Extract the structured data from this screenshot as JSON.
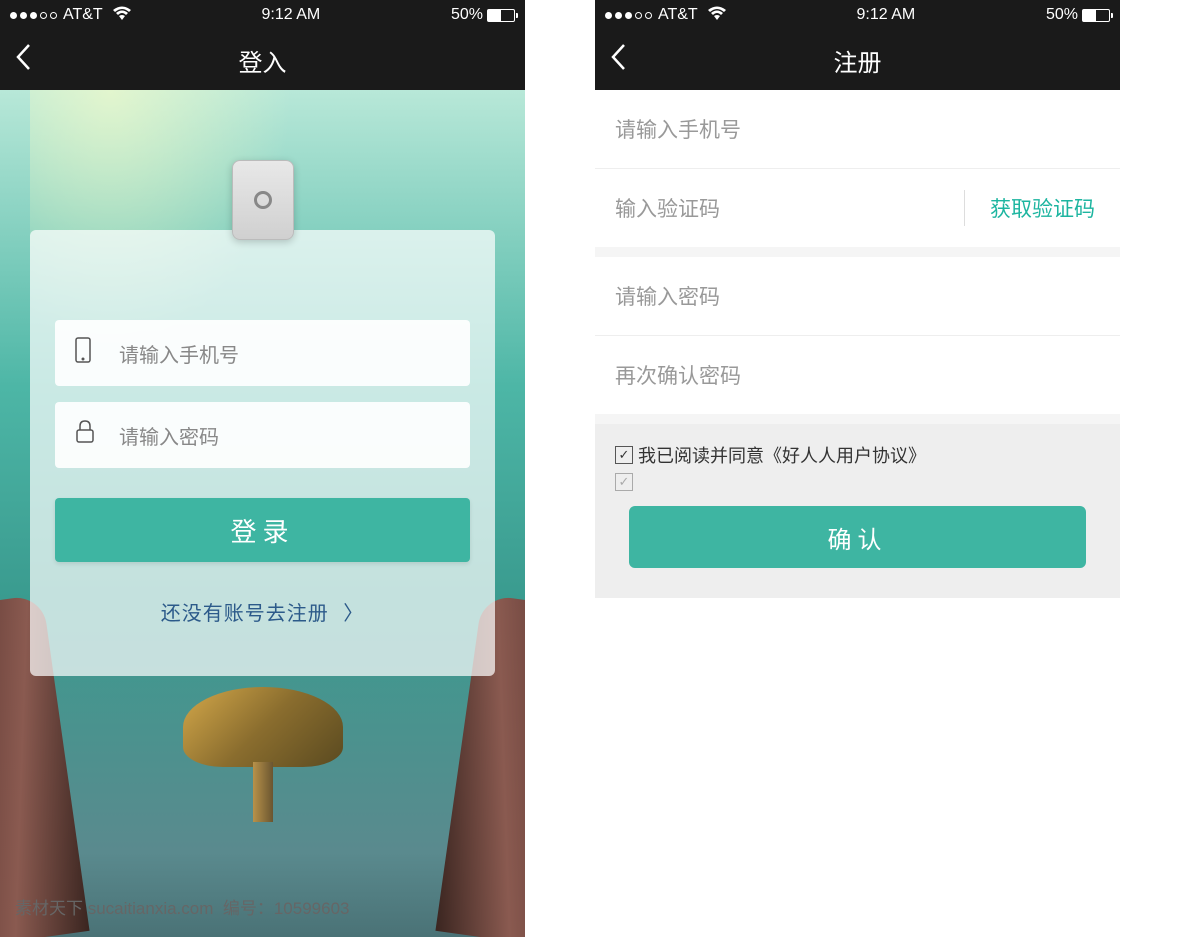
{
  "status": {
    "carrier": "AT&T",
    "time": "9:12 AM",
    "battery": "50%"
  },
  "login": {
    "title": "登入",
    "phone_placeholder": "请输入手机号",
    "password_placeholder": "请输入密码",
    "login_button": "登录",
    "register_link": "还没有账号去注册"
  },
  "register": {
    "title": "注册",
    "phone_placeholder": "请输入手机号",
    "verify_placeholder": "输入验证码",
    "verify_button": "获取验证码",
    "password_placeholder": "请输入密码",
    "confirm_password_placeholder": "再次确认密码",
    "agreement": "我已阅读并同意《好人人用户协议》",
    "confirm_button": "确认"
  },
  "watermark": {
    "site": "素材天下 sucaitianxia.com",
    "id_label": "编号：",
    "id": "10599603"
  }
}
